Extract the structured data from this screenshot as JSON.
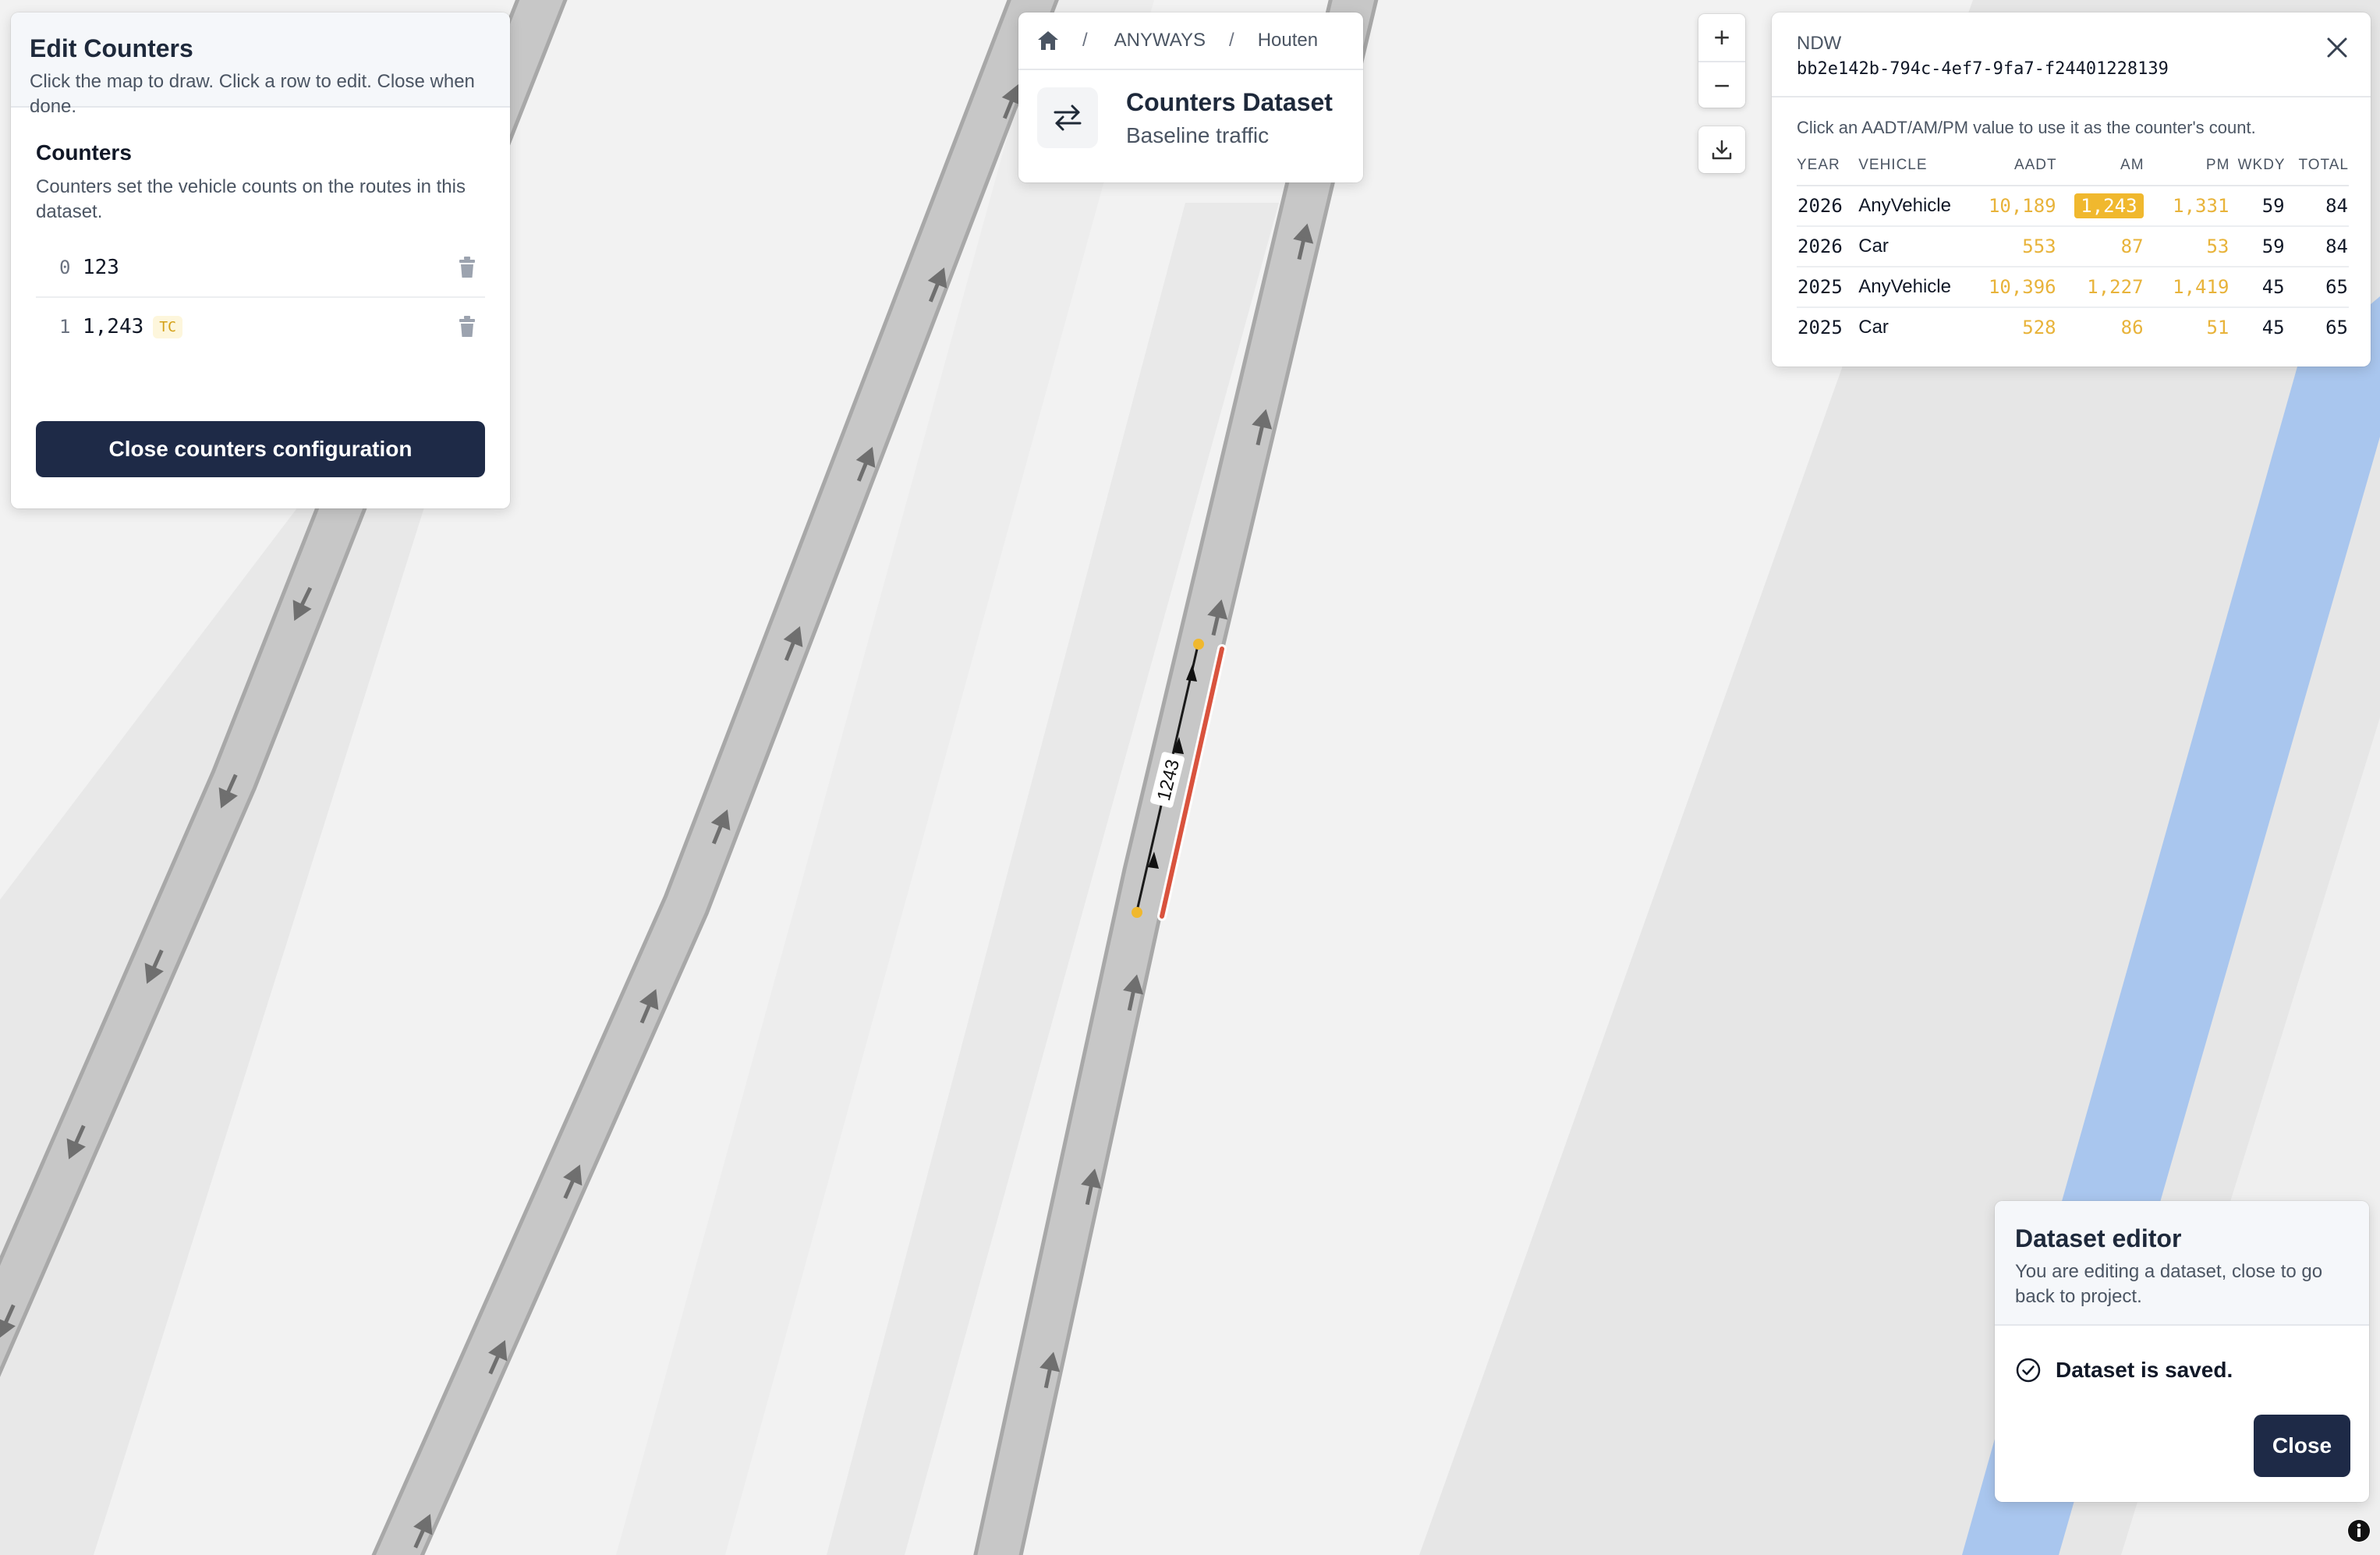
{
  "edit_counters": {
    "title": "Edit Counters",
    "subtitle": "Click the map to draw. Click a row to edit. Close when done.",
    "section_title": "Counters",
    "section_desc": "Counters set the vehicle counts on the routes in this dataset.",
    "counters": [
      {
        "index": "0",
        "value": "123",
        "badge": ""
      },
      {
        "index": "1",
        "value": "1,243",
        "badge": "TC"
      }
    ],
    "close_label": "Close counters configuration"
  },
  "dataset_header": {
    "breadcrumb": [
      "ANYWAYS",
      "Houten"
    ],
    "title": "Counters Dataset",
    "subtitle": "Baseline traffic"
  },
  "map_controls": {
    "zoom_in": "+",
    "zoom_out": "−"
  },
  "ndw": {
    "source": "NDW",
    "id": "bb2e142b-794c-4ef7-9fa7-f24401228139",
    "hint": "Click an AADT/AM/PM value to use it as the counter's count.",
    "columns": [
      "YEAR",
      "VEHICLE",
      "AADT",
      "AM",
      "PM",
      "WKDY",
      "TOTAL"
    ],
    "rows": [
      {
        "year": "2026",
        "vehicle": "AnyVehicle",
        "aadt": "10,189",
        "am": "1,243",
        "pm": "1,331",
        "wkdy": "59",
        "total": "84",
        "selected": "am"
      },
      {
        "year": "2026",
        "vehicle": "Car",
        "aadt": "553",
        "am": "87",
        "pm": "53",
        "wkdy": "59",
        "total": "84"
      },
      {
        "year": "2025",
        "vehicle": "AnyVehicle",
        "aadt": "10,396",
        "am": "1,227",
        "pm": "1,419",
        "wkdy": "45",
        "total": "65"
      },
      {
        "year": "2025",
        "vehicle": "Car",
        "aadt": "528",
        "am": "86",
        "pm": "51",
        "wkdy": "45",
        "total": "65"
      }
    ]
  },
  "map": {
    "route_label": "1243"
  },
  "dataset_editor": {
    "title": "Dataset editor",
    "subtitle": "You are editing a dataset, close to go back to project.",
    "status": "Dataset is saved.",
    "close_label": "Close"
  },
  "colors": {
    "primary_button": "#1e2a47",
    "value_gold": "#e8b33a",
    "highlight": "#f0b82e",
    "route_red": "#d9533e",
    "road_gray": "#c4c4c4",
    "water_blue": "#a9c6ee"
  }
}
